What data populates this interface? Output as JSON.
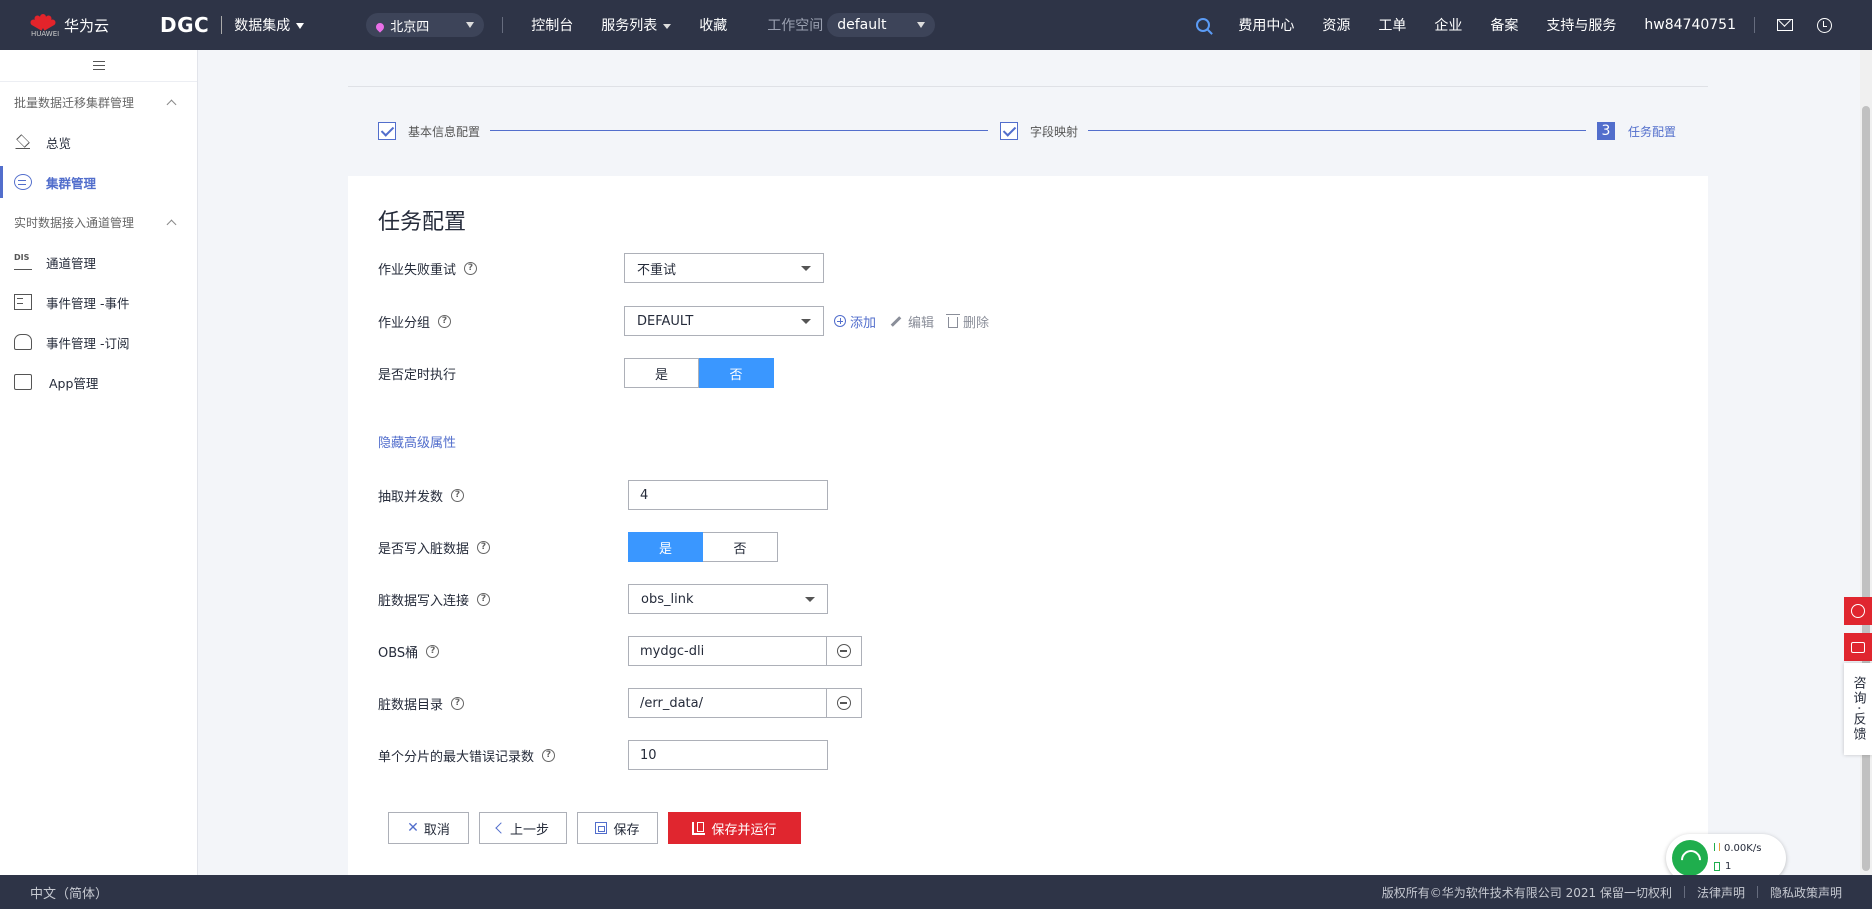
{
  "header": {
    "brand": "华为云",
    "brand_sub": "HUAWEI",
    "product": "DGC",
    "module": "数据集成",
    "region": "北京四",
    "nav": [
      "控制台",
      "服务列表",
      "收藏"
    ],
    "workspace_label": "工作空间",
    "workspace_value": "default",
    "right_items": [
      "费用中心",
      "资源",
      "工单",
      "企业",
      "备案",
      "支持与服务",
      "hw84740751"
    ]
  },
  "sidebar": {
    "groups": [
      {
        "title": "批量数据迁移集群管理",
        "items": [
          "总览",
          "集群管理"
        ]
      },
      {
        "title": "实时数据接入通道管理",
        "items": [
          "通道管理",
          "事件管理 -事件",
          "事件管理 -订阅",
          "App管理"
        ]
      }
    ],
    "active_item": "集群管理"
  },
  "steps": [
    {
      "label": "基本信息配置",
      "state": "done"
    },
    {
      "label": "字段映射",
      "state": "done"
    },
    {
      "label": "任务配置",
      "number": "3",
      "state": "current"
    }
  ],
  "form": {
    "title": "任务配置",
    "retry": {
      "label": "作业失败重试",
      "value": "不重试"
    },
    "group": {
      "label": "作业分组",
      "value": "DEFAULT",
      "add": "添加",
      "edit": "编辑",
      "delete": "删除"
    },
    "schedule": {
      "label": "是否定时执行",
      "yes": "是",
      "no": "否",
      "selected": "否"
    },
    "advanced_link": "隐藏高级属性",
    "concurrency": {
      "label": "抽取并发数",
      "value": "4"
    },
    "dirty": {
      "label": "是否写入脏数据",
      "yes": "是",
      "no": "否",
      "selected": "是"
    },
    "dirty_link": {
      "label": "脏数据写入连接",
      "value": "obs_link"
    },
    "obs_bucket": {
      "label": "OBS桶",
      "value": "mydgc-dli"
    },
    "dirty_dir": {
      "label": "脏数据目录",
      "value": "/err_data/"
    },
    "max_errors": {
      "label": "单个分片的最大错误记录数",
      "value": "10"
    }
  },
  "buttons": {
    "cancel": "取消",
    "prev": "上一步",
    "save": "保存",
    "save_run": "保存并运行"
  },
  "float": {
    "feedback_text": "咨询·反馈"
  },
  "net_widget": {
    "speed": "0.00K/s",
    "count": "1"
  },
  "footer": {
    "language": "中文（简体）",
    "copyright": "版权所有©华为软件技术有限公司 2021 保留一切权利",
    "legal": "法律声明",
    "privacy": "隐私政策声明"
  },
  "colors": {
    "primary": "#526ecc",
    "toggle_on": "#3a97ff",
    "danger": "#e0262f",
    "topbar": "#2e3447"
  }
}
